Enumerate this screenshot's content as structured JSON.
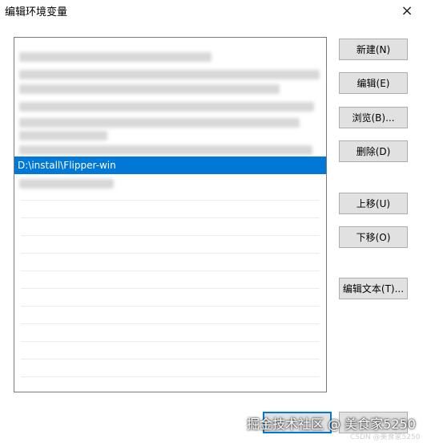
{
  "window": {
    "title": "编辑环境变量",
    "close_icon": "×"
  },
  "list": {
    "selected_entry": "D:\\install\\Flipper-win"
  },
  "buttons": {
    "new": "新建(N)",
    "edit": "编辑(E)",
    "browse": "浏览(B)...",
    "delete": "删除(D)",
    "move_up": "上移(U)",
    "move_down": "下移(O)",
    "edit_text": "编辑文本(T)..."
  },
  "footer": {
    "watermark": "掘金技术社区 @ 美食家5250",
    "csdn_watermark": "CSDN @美食家5250"
  },
  "colors": {
    "selection": "#0078d7",
    "button_face": "#e1e1e1"
  }
}
